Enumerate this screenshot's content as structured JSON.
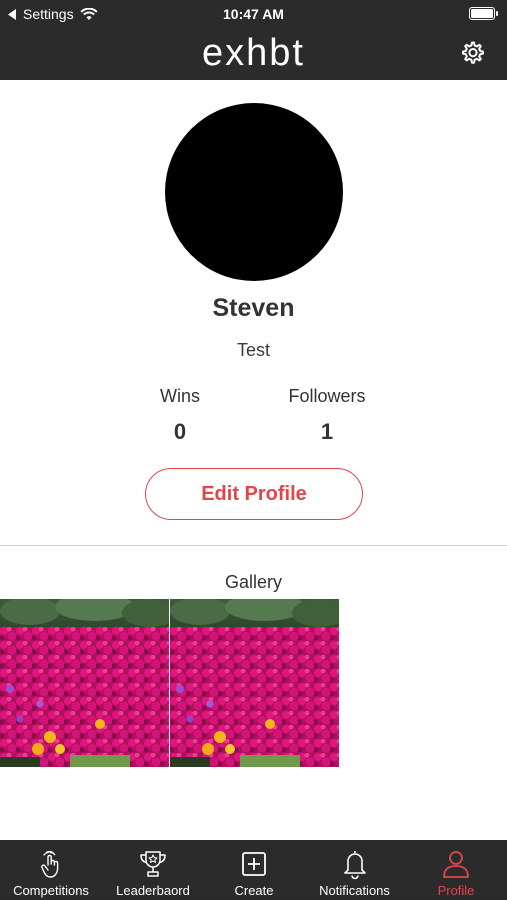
{
  "status_bar": {
    "back_label": "Settings",
    "time": "10:47 AM",
    "wifi_icon": "wifi-icon",
    "battery_icon": "battery-icon"
  },
  "app_bar": {
    "logo": "exhbt",
    "settings_icon": "gear-icon"
  },
  "profile": {
    "name": "Steven",
    "bio": "Test",
    "stats": {
      "wins_label": "Wins",
      "wins_value": "0",
      "followers_label": "Followers",
      "followers_value": "1"
    },
    "edit_button": "Edit Profile"
  },
  "gallery": {
    "title": "Gallery",
    "items": [
      {
        "image": "magenta flowers in a garden with green trees behind"
      },
      {
        "image": "magenta flowers in a garden with green trees behind"
      }
    ]
  },
  "tab_bar": {
    "tabs": [
      {
        "label": "Competitions",
        "icon": "touch-hand-icon",
        "active": false
      },
      {
        "label": "Leaderbaord",
        "icon": "trophy-icon",
        "active": false
      },
      {
        "label": "Create",
        "icon": "plus-square-icon",
        "active": false
      },
      {
        "label": "Notifications",
        "icon": "bell-icon",
        "active": false
      },
      {
        "label": "Profile",
        "icon": "person-icon",
        "active": true
      }
    ]
  },
  "colors": {
    "bar_background": "#2b2b2b",
    "accent": "#e0464c",
    "text": "#333333"
  }
}
